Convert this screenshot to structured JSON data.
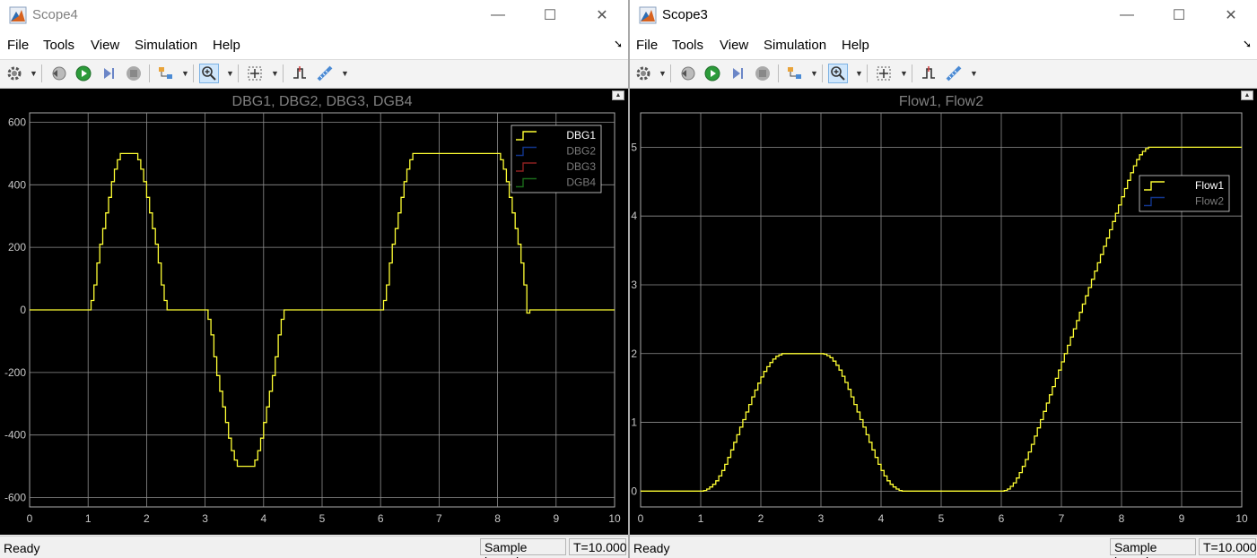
{
  "windows": [
    {
      "title": "Scope4",
      "menu": [
        "File",
        "Tools",
        "View",
        "Simulation",
        "Help"
      ],
      "status": {
        "ready": "Ready",
        "mode": "Sample based",
        "time": "T=10.000"
      },
      "chart_data": {
        "type": "line",
        "title": "DBG1, DBG2, DBG3, DGB4",
        "xlim": [
          0,
          10
        ],
        "ylim": [
          -630,
          630
        ],
        "xticks": [
          0,
          1,
          2,
          3,
          4,
          5,
          6,
          7,
          8,
          9,
          10
        ],
        "yticks": [
          -600,
          -400,
          -200,
          0,
          200,
          400,
          600
        ],
        "grid": true,
        "legend_position": "top-right",
        "colors": {
          "background": "#000000",
          "grid": "#8f8f8f",
          "axis_text": "#c8c8c8",
          "title": "#808080"
        },
        "series": [
          {
            "name": "DBG1",
            "color": "#ffff33",
            "visible": true,
            "step": true,
            "x": [
              0,
              1,
              1.05,
              1.1,
              1.15,
              1.2,
              1.25,
              1.3,
              1.35,
              1.4,
              1.45,
              1.5,
              1.55,
              1.8,
              1.85,
              1.9,
              1.95,
              2.0,
              2.05,
              2.1,
              2.15,
              2.2,
              2.25,
              2.3,
              2.35,
              3.0,
              3.05,
              3.1,
              3.15,
              3.2,
              3.25,
              3.3,
              3.35,
              3.4,
              3.45,
              3.5,
              3.55,
              3.8,
              3.85,
              3.9,
              3.95,
              4.0,
              4.05,
              4.1,
              4.15,
              4.2,
              4.25,
              4.3,
              4.35,
              6.0,
              6.05,
              6.1,
              6.15,
              6.2,
              6.25,
              6.3,
              6.35,
              6.4,
              6.45,
              6.5,
              6.55,
              8.0,
              8.05,
              8.1,
              8.15,
              8.2,
              8.25,
              8.3,
              8.35,
              8.4,
              8.45,
              8.5,
              8.55,
              10.0
            ],
            "y": [
              0,
              0,
              30,
              80,
              150,
              210,
              260,
              310,
              360,
              410,
              450,
              480,
              500,
              500,
              480,
              450,
              410,
              360,
              310,
              260,
              210,
              150,
              80,
              30,
              0,
              0,
              -30,
              -80,
              -150,
              -210,
              -260,
              -310,
              -360,
              -410,
              -450,
              -480,
              -500,
              -500,
              -480,
              -450,
              -410,
              -360,
              -310,
              -260,
              -210,
              -150,
              -80,
              -30,
              0,
              0,
              30,
              80,
              150,
              210,
              260,
              310,
              360,
              410,
              450,
              480,
              500,
              500,
              480,
              450,
              410,
              360,
              310,
              260,
              210,
              150,
              80,
              -10,
              0,
              0
            ]
          },
          {
            "name": "DBG2",
            "color": "#2060ff",
            "visible": false
          },
          {
            "name": "DBG3",
            "color": "#ff3b3b",
            "visible": false
          },
          {
            "name": "DGB4",
            "color": "#30c030",
            "visible": false
          }
        ]
      }
    },
    {
      "title": "Scope3",
      "menu": [
        "File",
        "Tools",
        "View",
        "Simulation",
        "Help"
      ],
      "status": {
        "ready": "Ready",
        "mode": "Sample based",
        "time": "T=10.000"
      },
      "chart_data": {
        "type": "line",
        "title": "Flow1, Flow2",
        "xlim": [
          0,
          10
        ],
        "ylim": [
          -0.23,
          5.5
        ],
        "xticks": [
          0,
          1,
          2,
          3,
          4,
          5,
          6,
          7,
          8,
          9,
          10
        ],
        "yticks": [
          0,
          1,
          2,
          3,
          4,
          5
        ],
        "grid": true,
        "legend_position": "top-right",
        "colors": {
          "background": "#000000",
          "grid": "#8f8f8f",
          "axis_text": "#c8c8c8",
          "title": "#808080"
        },
        "series": [
          {
            "name": "Flow1",
            "color": "#ffff33",
            "visible": true,
            "step": true,
            "x": [
              0,
              1,
              1.05,
              1.1,
              1.15,
              1.2,
              1.25,
              1.3,
              1.35,
              1.4,
              1.45,
              1.5,
              1.55,
              1.6,
              1.65,
              1.7,
              1.75,
              1.8,
              1.85,
              1.9,
              1.95,
              2.0,
              2.05,
              2.1,
              2.15,
              2.2,
              2.25,
              2.3,
              2.35,
              2.4,
              2.45,
              3.0,
              3.05,
              3.1,
              3.15,
              3.2,
              3.25,
              3.3,
              3.35,
              3.4,
              3.45,
              3.5,
              3.55,
              3.6,
              3.65,
              3.7,
              3.75,
              3.8,
              3.85,
              3.9,
              3.95,
              4.0,
              4.05,
              4.1,
              4.15,
              4.2,
              4.25,
              4.3,
              4.35,
              4.4,
              4.45,
              6.0,
              6.05,
              6.1,
              6.15,
              6.2,
              6.25,
              6.3,
              6.35,
              6.4,
              6.45,
              6.5,
              6.55,
              6.6,
              6.65,
              6.7,
              6.75,
              6.8,
              6.85,
              6.9,
              6.95,
              7.0,
              7.05,
              7.1,
              7.15,
              7.2,
              7.25,
              7.3,
              7.35,
              7.4,
              7.45,
              7.5,
              7.55,
              7.6,
              7.65,
              7.7,
              7.75,
              7.8,
              7.85,
              7.9,
              7.95,
              8.0,
              8.05,
              8.1,
              8.15,
              8.2,
              8.25,
              8.3,
              8.35,
              8.4,
              8.45,
              8.5,
              10.0
            ],
            "y": [
              0,
              0,
              0.01,
              0.03,
              0.06,
              0.1,
              0.15,
              0.22,
              0.3,
              0.39,
              0.49,
              0.6,
              0.71,
              0.82,
              0.93,
              1.04,
              1.15,
              1.26,
              1.37,
              1.47,
              1.57,
              1.66,
              1.74,
              1.81,
              1.87,
              1.92,
              1.96,
              1.98,
              2.0,
              2.0,
              2.0,
              2.0,
              1.99,
              1.97,
              1.94,
              1.89,
              1.83,
              1.76,
              1.67,
              1.58,
              1.48,
              1.37,
              1.26,
              1.15,
              1.04,
              0.93,
              0.82,
              0.71,
              0.6,
              0.49,
              0.39,
              0.3,
              0.22,
              0.15,
              0.1,
              0.06,
              0.03,
              0.01,
              0.0,
              0.0,
              0.0,
              0.0,
              0.01,
              0.03,
              0.07,
              0.12,
              0.19,
              0.27,
              0.36,
              0.46,
              0.57,
              0.68,
              0.8,
              0.92,
              1.04,
              1.16,
              1.28,
              1.4,
              1.52,
              1.64,
              1.76,
              1.88,
              2.0,
              2.12,
              2.24,
              2.36,
              2.48,
              2.6,
              2.72,
              2.84,
              2.96,
              3.08,
              3.2,
              3.32,
              3.44,
              3.56,
              3.68,
              3.8,
              3.92,
              4.04,
              4.16,
              4.28,
              4.4,
              4.52,
              4.63,
              4.73,
              4.82,
              4.89,
              4.94,
              4.98,
              5.0,
              5.0,
              5.0
            ]
          },
          {
            "name": "Flow2",
            "color": "#2060ff",
            "visible": false
          }
        ]
      }
    }
  ]
}
